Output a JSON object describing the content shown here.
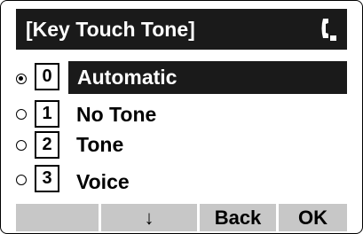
{
  "header": {
    "title": "[Key Touch Tone]",
    "icon": "handset-icon"
  },
  "options": [
    {
      "number": "0",
      "label": "Automatic",
      "selected": true
    },
    {
      "number": "1",
      "label": "No Tone",
      "selected": false
    },
    {
      "number": "2",
      "label": "Tone",
      "selected": false
    },
    {
      "number": "3",
      "label": "Voice",
      "selected": false
    }
  ],
  "softkeys": [
    {
      "label": ""
    },
    {
      "label": "↓"
    },
    {
      "label": "Back"
    },
    {
      "label": "OK"
    }
  ]
}
